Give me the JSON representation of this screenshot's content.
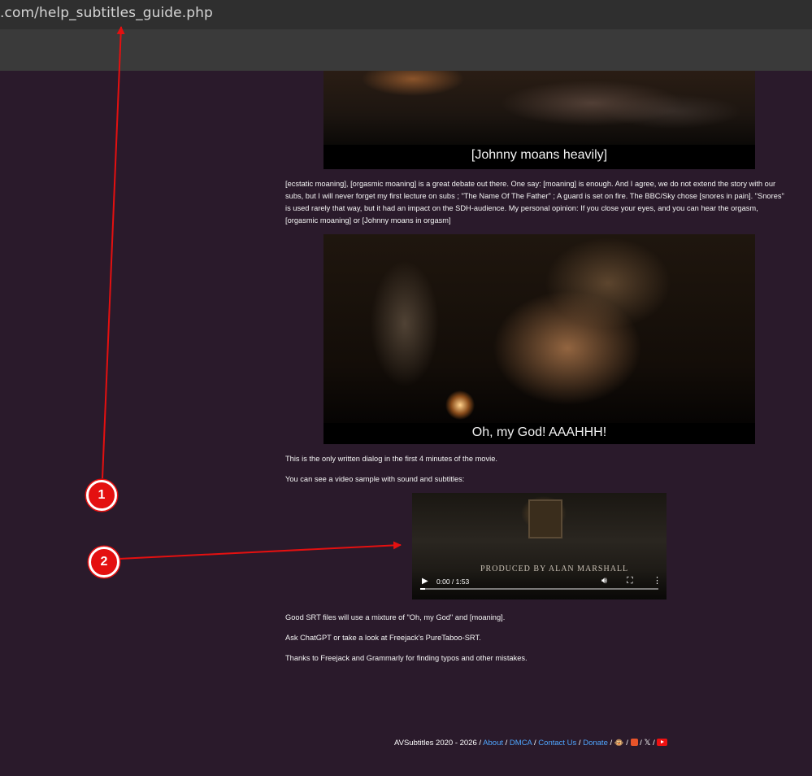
{
  "browser": {
    "url": ".com/help_subtitles_guide.php"
  },
  "captions": {
    "first": "[Johnny moans heavily]",
    "second": "Oh, my God! AAAHHH!"
  },
  "text": {
    "paragraph1": "[ecstatic moaning], [orgasmic moaning] is a great debate out there. One say: [moaning] is enough. And I agree, we do not extend the story with our subs, but I will never forget my first lecture on subs ; \"The Name Of The Father\" ; A guard is set on fire. The BBC/Sky chose [snores in pain]. \"Snores\" is used rarely that way, but it had an impact on the SDH-audience. My personal opinion: If you close your eyes, and you can hear the orgasm, [orgasmic moaning] or [Johnny moans in orgasm]",
    "paragraph2": "This is the only written dialog in the first 4 minutes of the movie.",
    "paragraph3": "You can see a video sample with sound and subtitles:",
    "paragraph4": "Good SRT files will use a mixture of \"Oh, my God\" and [moaning].",
    "paragraph5": "Ask ChatGPT or take a look at Freejack's PureTaboo-SRT.",
    "paragraph6": "Thanks to Freejack and Grammarly for finding typos and other mistakes."
  },
  "video": {
    "overlay_text": "PRODUCED BY ALAN MARSHALL",
    "time": "0:00 / 1:53",
    "progress": 0.0,
    "icons": [
      "play-icon",
      "volume-icon",
      "fullscreen-icon",
      "more-options-icon"
    ]
  },
  "footer": {
    "prefix": "AVSubtitles 2020 - 2026 /",
    "links": [
      "About",
      "DMCA",
      "Contact Us",
      "Donate"
    ],
    "icons": [
      "emoji-icon",
      "instagram-icon",
      "x-icon",
      "youtube-icon"
    ]
  },
  "markers": [
    "1",
    "2"
  ],
  "colors": {
    "background": "#2a1a2b",
    "link": "#4fa6ff",
    "marker": "#e41010"
  }
}
